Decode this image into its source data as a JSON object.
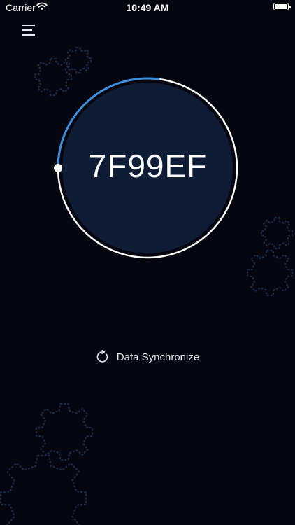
{
  "status_bar": {
    "carrier": "Carrier",
    "time": "10:49 AM"
  },
  "token": {
    "code": "7F99EF",
    "progress_fraction": 0.27
  },
  "sync": {
    "label": "Data Synchronize",
    "icon": "refresh-icon"
  },
  "colors": {
    "background": "#05060f",
    "dial_fill": "#0f1c35",
    "ring": "#ffffff",
    "progress": "#3d8fe0",
    "gear_outline": "#1b2a45"
  }
}
